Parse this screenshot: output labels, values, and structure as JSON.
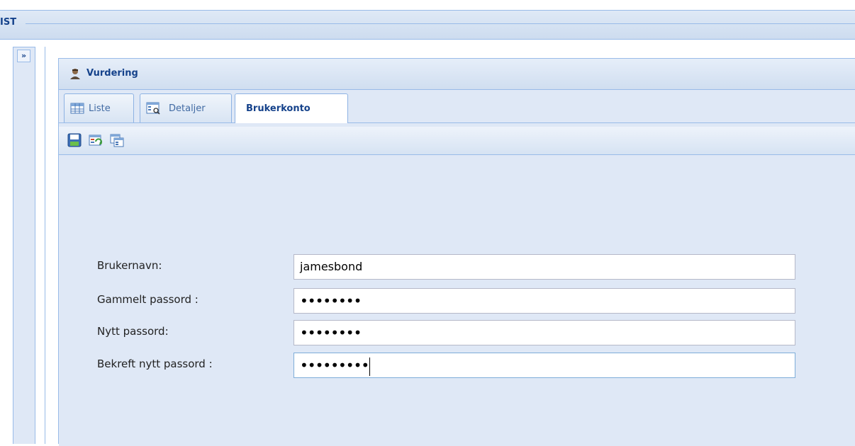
{
  "app": {
    "title": "IST",
    "expand_label": "»"
  },
  "panel": {
    "title": "Vurdering",
    "icon": "user-icon"
  },
  "tabs": [
    {
      "label": "Liste",
      "icon": "grid-icon",
      "active": false
    },
    {
      "label": "Detaljer",
      "icon": "details-icon",
      "active": false
    },
    {
      "label": "Brukerkonto",
      "icon": null,
      "active": true
    }
  ],
  "toolbar": {
    "buttons": [
      {
        "name": "save-icon"
      },
      {
        "name": "refresh-record-icon"
      },
      {
        "name": "copy-record-icon"
      }
    ]
  },
  "form": {
    "username_label": "Brukernavn:",
    "username_value": "jamesbond",
    "old_password_label": "Gammelt passord :",
    "old_password_value": "••••••••",
    "new_password_label": "Nytt passord:",
    "new_password_value": "••••••••",
    "confirm_password_label": "Bekreft nytt passord :",
    "confirm_password_value": "•••••••••"
  },
  "colors": {
    "accent": "#15428b",
    "border": "#99bbe8",
    "panel_bg": "#dfe8f6"
  }
}
